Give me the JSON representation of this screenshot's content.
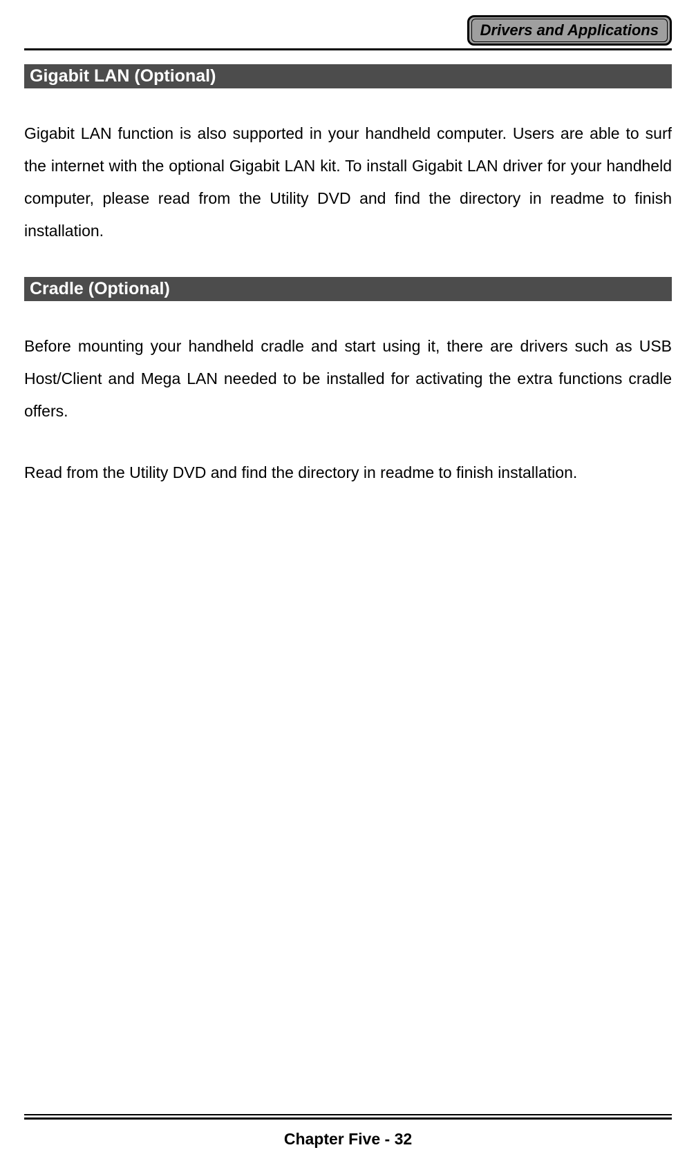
{
  "header": {
    "badge": "Drivers and Applications"
  },
  "sections": [
    {
      "heading": "Gigabit LAN (Optional)",
      "paragraphs": [
        "Gigabit LAN function is also supported in your handheld computer. Users are able to surf the internet with the optional Gigabit LAN kit. To install Gigabit LAN driver for your handheld computer, please read from the Utility DVD and find the directory in readme to finish installation."
      ]
    },
    {
      "heading": "Cradle (Optional)",
      "paragraphs": [
        "Before mounting your handheld cradle and start using it, there are drivers such as USB Host/Client and Mega LAN needed to be installed for activating the extra functions cradle offers.",
        "Read from the Utility DVD and find the directory in readme to finish installation."
      ]
    }
  ],
  "footer": {
    "page_label": "Chapter Five - 32"
  }
}
